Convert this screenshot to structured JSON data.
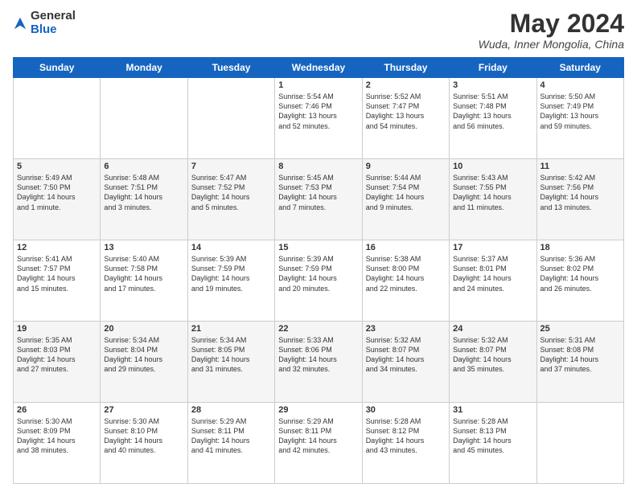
{
  "logo": {
    "general": "General",
    "blue": "Blue"
  },
  "header": {
    "month_year": "May 2024",
    "location": "Wuda, Inner Mongolia, China"
  },
  "days_of_week": [
    "Sunday",
    "Monday",
    "Tuesday",
    "Wednesday",
    "Thursday",
    "Friday",
    "Saturday"
  ],
  "weeks": [
    [
      {
        "day": "",
        "info": ""
      },
      {
        "day": "",
        "info": ""
      },
      {
        "day": "",
        "info": ""
      },
      {
        "day": "1",
        "info": "Sunrise: 5:54 AM\nSunset: 7:46 PM\nDaylight: 13 hours\nand 52 minutes."
      },
      {
        "day": "2",
        "info": "Sunrise: 5:52 AM\nSunset: 7:47 PM\nDaylight: 13 hours\nand 54 minutes."
      },
      {
        "day": "3",
        "info": "Sunrise: 5:51 AM\nSunset: 7:48 PM\nDaylight: 13 hours\nand 56 minutes."
      },
      {
        "day": "4",
        "info": "Sunrise: 5:50 AM\nSunset: 7:49 PM\nDaylight: 13 hours\nand 59 minutes."
      }
    ],
    [
      {
        "day": "5",
        "info": "Sunrise: 5:49 AM\nSunset: 7:50 PM\nDaylight: 14 hours\nand 1 minute."
      },
      {
        "day": "6",
        "info": "Sunrise: 5:48 AM\nSunset: 7:51 PM\nDaylight: 14 hours\nand 3 minutes."
      },
      {
        "day": "7",
        "info": "Sunrise: 5:47 AM\nSunset: 7:52 PM\nDaylight: 14 hours\nand 5 minutes."
      },
      {
        "day": "8",
        "info": "Sunrise: 5:45 AM\nSunset: 7:53 PM\nDaylight: 14 hours\nand 7 minutes."
      },
      {
        "day": "9",
        "info": "Sunrise: 5:44 AM\nSunset: 7:54 PM\nDaylight: 14 hours\nand 9 minutes."
      },
      {
        "day": "10",
        "info": "Sunrise: 5:43 AM\nSunset: 7:55 PM\nDaylight: 14 hours\nand 11 minutes."
      },
      {
        "day": "11",
        "info": "Sunrise: 5:42 AM\nSunset: 7:56 PM\nDaylight: 14 hours\nand 13 minutes."
      }
    ],
    [
      {
        "day": "12",
        "info": "Sunrise: 5:41 AM\nSunset: 7:57 PM\nDaylight: 14 hours\nand 15 minutes."
      },
      {
        "day": "13",
        "info": "Sunrise: 5:40 AM\nSunset: 7:58 PM\nDaylight: 14 hours\nand 17 minutes."
      },
      {
        "day": "14",
        "info": "Sunrise: 5:39 AM\nSunset: 7:59 PM\nDaylight: 14 hours\nand 19 minutes."
      },
      {
        "day": "15",
        "info": "Sunrise: 5:39 AM\nSunset: 7:59 PM\nDaylight: 14 hours\nand 20 minutes."
      },
      {
        "day": "16",
        "info": "Sunrise: 5:38 AM\nSunset: 8:00 PM\nDaylight: 14 hours\nand 22 minutes."
      },
      {
        "day": "17",
        "info": "Sunrise: 5:37 AM\nSunset: 8:01 PM\nDaylight: 14 hours\nand 24 minutes."
      },
      {
        "day": "18",
        "info": "Sunrise: 5:36 AM\nSunset: 8:02 PM\nDaylight: 14 hours\nand 26 minutes."
      }
    ],
    [
      {
        "day": "19",
        "info": "Sunrise: 5:35 AM\nSunset: 8:03 PM\nDaylight: 14 hours\nand 27 minutes."
      },
      {
        "day": "20",
        "info": "Sunrise: 5:34 AM\nSunset: 8:04 PM\nDaylight: 14 hours\nand 29 minutes."
      },
      {
        "day": "21",
        "info": "Sunrise: 5:34 AM\nSunset: 8:05 PM\nDaylight: 14 hours\nand 31 minutes."
      },
      {
        "day": "22",
        "info": "Sunrise: 5:33 AM\nSunset: 8:06 PM\nDaylight: 14 hours\nand 32 minutes."
      },
      {
        "day": "23",
        "info": "Sunrise: 5:32 AM\nSunset: 8:07 PM\nDaylight: 14 hours\nand 34 minutes."
      },
      {
        "day": "24",
        "info": "Sunrise: 5:32 AM\nSunset: 8:07 PM\nDaylight: 14 hours\nand 35 minutes."
      },
      {
        "day": "25",
        "info": "Sunrise: 5:31 AM\nSunset: 8:08 PM\nDaylight: 14 hours\nand 37 minutes."
      }
    ],
    [
      {
        "day": "26",
        "info": "Sunrise: 5:30 AM\nSunset: 8:09 PM\nDaylight: 14 hours\nand 38 minutes."
      },
      {
        "day": "27",
        "info": "Sunrise: 5:30 AM\nSunset: 8:10 PM\nDaylight: 14 hours\nand 40 minutes."
      },
      {
        "day": "28",
        "info": "Sunrise: 5:29 AM\nSunset: 8:11 PM\nDaylight: 14 hours\nand 41 minutes."
      },
      {
        "day": "29",
        "info": "Sunrise: 5:29 AM\nSunset: 8:11 PM\nDaylight: 14 hours\nand 42 minutes."
      },
      {
        "day": "30",
        "info": "Sunrise: 5:28 AM\nSunset: 8:12 PM\nDaylight: 14 hours\nand 43 minutes."
      },
      {
        "day": "31",
        "info": "Sunrise: 5:28 AM\nSunset: 8:13 PM\nDaylight: 14 hours\nand 45 minutes."
      },
      {
        "day": "",
        "info": ""
      }
    ]
  ]
}
